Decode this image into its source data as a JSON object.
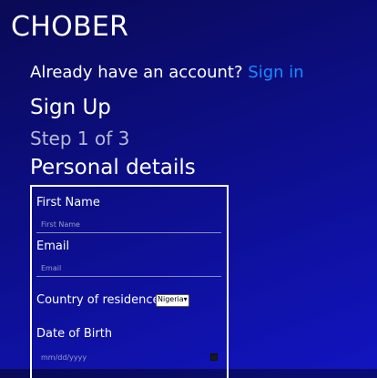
{
  "brand": {
    "title": "CHOBER"
  },
  "signin": {
    "prompt": "Already have an account?",
    "link": "Sign in"
  },
  "headings": {
    "signup": "Sign Up",
    "step": "Step 1 of 3",
    "section": "Personal details"
  },
  "form": {
    "first_name": {
      "label": "First Name",
      "placeholder": "First Name"
    },
    "email": {
      "label": "Email",
      "placeholder": "Email"
    },
    "country": {
      "label": "Country of residence",
      "selected": "Nigeria"
    },
    "dob": {
      "label": "Date of Birth",
      "placeholder": "mm/dd/yyyy"
    }
  },
  "colors": {
    "link": "#1a8cff",
    "background_top": "#0a0a55",
    "background_bottom": "#1214c0"
  },
  "icons": {
    "calendar": "calendar-icon"
  }
}
